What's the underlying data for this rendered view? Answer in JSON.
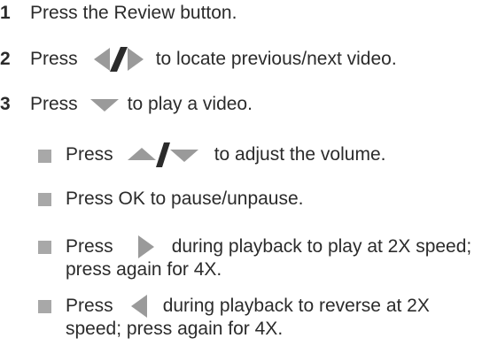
{
  "steps": [
    {
      "num": "1",
      "text": "Press the Review button."
    },
    {
      "num": "2",
      "pre": "Press",
      "post": "to locate previous/next video."
    },
    {
      "num": "3",
      "pre": "Press",
      "post": "to play a video."
    }
  ],
  "bullets": [
    {
      "pre": "Press",
      "post": "to adjust the volume."
    },
    {
      "text": "Press OK to pause/unpause."
    },
    {
      "pre": "Press",
      "post": "during playback to play at 2X speed;",
      "cont": "press again for 4X."
    },
    {
      "pre": "Press",
      "post": "during playback to reverse at 2X",
      "cont": "speed; press again for 4X."
    }
  ],
  "icons": {
    "step2": [
      "left-arrow-icon",
      "slash-icon",
      "right-arrow-icon"
    ],
    "step3": [
      "down-arrow-icon"
    ],
    "bullet1": [
      "up-arrow-icon",
      "slash-icon",
      "down-arrow-icon"
    ],
    "bullet3": [
      "right-arrow-icon"
    ],
    "bullet4": [
      "left-arrow-icon"
    ]
  },
  "colors": {
    "text": "#2b2b2b",
    "icon": "#9a9a9a",
    "bullet": "#a8a8a8"
  }
}
